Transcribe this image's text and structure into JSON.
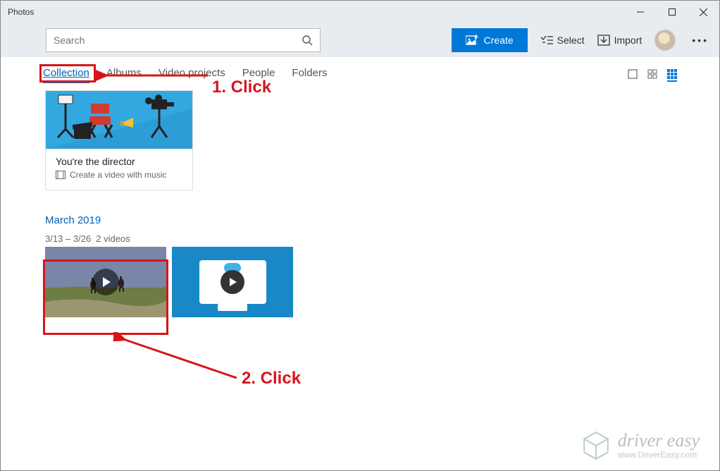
{
  "window": {
    "title": "Photos"
  },
  "toolbar": {
    "search_placeholder": "Search",
    "create_label": "Create",
    "select_label": "Select",
    "import_label": "Import"
  },
  "tabs": {
    "items": [
      {
        "label": "Collection",
        "active": true
      },
      {
        "label": "Albums",
        "active": false
      },
      {
        "label": "Video projects",
        "active": false
      },
      {
        "label": "People",
        "active": false
      },
      {
        "label": "Folders",
        "active": false
      }
    ]
  },
  "promo_card": {
    "title": "You're the director",
    "subtitle": "Create a video with music"
  },
  "date_group": {
    "title": "March 2019",
    "range": "3/13 – 3/26",
    "count_label": "2 videos"
  },
  "annotations": {
    "step1": "1. Click",
    "step2": "2. Click"
  },
  "watermark": {
    "brand": "driver easy",
    "url": "www.DriverEasy.com"
  }
}
